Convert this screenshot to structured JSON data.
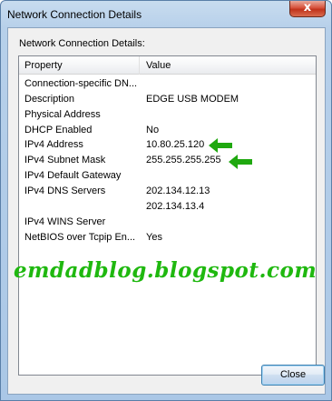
{
  "window": {
    "title": "Network Connection Details",
    "close_glyph": "x"
  },
  "heading": "Network Connection Details:",
  "columns": {
    "property": "Property",
    "value": "Value"
  },
  "rows": [
    {
      "property": "Connection-specific DN...",
      "value": ""
    },
    {
      "property": "Description",
      "value": "EDGE USB MODEM"
    },
    {
      "property": "Physical Address",
      "value": ""
    },
    {
      "property": "DHCP Enabled",
      "value": "No"
    },
    {
      "property": "IPv4 Address",
      "value": "10.80.25.120"
    },
    {
      "property": "IPv4 Subnet Mask",
      "value": "255.255.255.255"
    },
    {
      "property": "IPv4 Default Gateway",
      "value": ""
    },
    {
      "property": "IPv4 DNS Servers",
      "value": "202.134.12.13"
    },
    {
      "property": "",
      "value": "202.134.13.4"
    },
    {
      "property": "IPv4 WINS Server",
      "value": ""
    },
    {
      "property": "NetBIOS over Tcpip En...",
      "value": "Yes"
    }
  ],
  "watermark": "emdadblog.blogspot.com",
  "buttons": {
    "close": "Close"
  },
  "colors": {
    "arrow": "#1fa80f",
    "watermark": "#1fb80f"
  },
  "icons": {
    "arrow_address": "arrow-left-icon",
    "arrow_mask": "arrow-left-icon"
  }
}
